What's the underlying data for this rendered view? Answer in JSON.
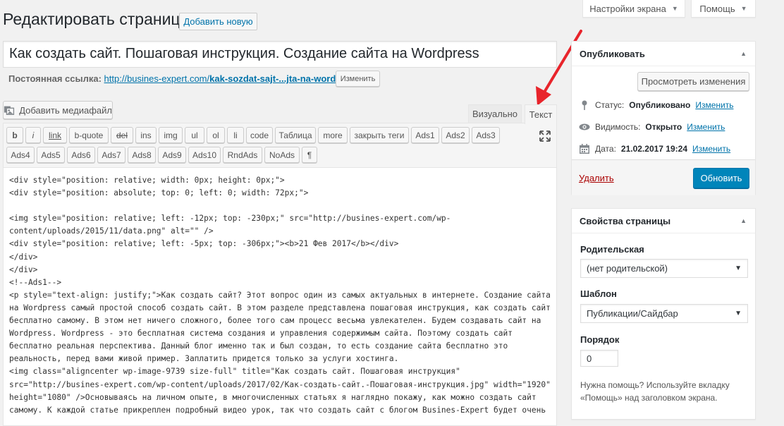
{
  "header": {
    "title": "Редактировать страницу",
    "add_new": "Добавить новую",
    "screen_options": "Настройки экрана",
    "help": "Помощь"
  },
  "post": {
    "title": "Как создать сайт. Пошаговая инструкция. Создание сайта на Wordpress",
    "permalink_label": "Постоянная ссылка:",
    "permalink_base": "http://busines-expert.com/",
    "permalink_slug": "kak-sozdat-sajt-...jta-na-wordpress",
    "permalink_end": "/",
    "permalink_edit": "Изменить"
  },
  "editor": {
    "add_media": "Добавить медиафайл",
    "tab_visual": "Визуально",
    "tab_text": "Текст",
    "toolbar_row1": [
      "b",
      "i",
      "link",
      "b-quote",
      "del",
      "ins",
      "img",
      "ul",
      "ol",
      "li",
      "code",
      "Таблица",
      "more",
      "закрыть теги",
      "Ads1",
      "Ads2",
      "Ads3"
    ],
    "toolbar_row2": [
      "Ads4",
      "Ads5",
      "Ads6",
      "Ads7",
      "Ads8",
      "Ads9",
      "Ads10",
      "RndAds",
      "NoAds",
      "¶"
    ],
    "content": "<div style=\"position: relative; width: 0px; height: 0px;\">\n<div style=\"position: absolute; top: 0; left: 0; width: 72px;\">\n\n<img style=\"position: relative; left: -12px; top: -230px;\" src=\"http://busines-expert.com/wp-\ncontent/uploads/2015/11/data.png\" alt=\"\" />\n<div style=\"position: relative; left: -5px; top: -306px;\"><b>21 Фев 2017</b></div>\n</div>\n</div>\n<!--Ads1-->\n<p style=\"text-align: justify;\">Как создать сайт? Этот вопрос один из самых актуальных в интернете. Создание сайта\nна Wordpress самый простой способ создать сайт. В этом разделе представлена пошаговая инструкция, как создать сайт\nбесплатно самому. В этом нет ничего сложного, более того сам процесс весьма увлекателен. Будем создавать сайт на\nWordpress. Wordpress - это бесплатная система создания и управления содержимым сайта. Поэтому создать сайт\nбесплатно реальная перспектива. Данный блог именно так и был создан, то есть создание сайта бесплатно это\nреальность, перед вами живой пример. Заплатить придется только за услуги хостинга.\n<img class=\"aligncenter wp-image-9739 size-full\" title=\"Как создать сайт. Пошаговая инструкция\"\nsrc=\"http://busines-expert.com/wp-content/uploads/2017/02/Как-создать-сайт.-Пошаговая-инструкция.jpg\" width=\"1920\"\nheight=\"1080\" />Основываясь на личном опыте, в многочисленных статьях я наглядно покажу, как можно создать сайт\nсамому. К каждой статье прикреплен подробный видео урок, так что создать сайт с блогом Busines-Expert будет очень"
  },
  "publish": {
    "title": "Опубликовать",
    "preview": "Просмотреть изменения",
    "status_label": "Статус:",
    "status_value": "Опубликовано",
    "status_edit": "Изменить",
    "visibility_label": "Видимость:",
    "visibility_value": "Открыто",
    "visibility_edit": "Изменить",
    "date_label": "Дата:",
    "date_value": "21.02.2017 19:24",
    "date_edit": "Изменить",
    "delete": "Удалить",
    "update": "Обновить"
  },
  "attributes": {
    "title": "Свойства страницы",
    "parent_label": "Родительская",
    "parent_value": "(нет родительской)",
    "template_label": "Шаблон",
    "template_value": "Публикации/Сайдбар",
    "order_label": "Порядок",
    "order_value": "0",
    "help_text_1": "Нужна помощь? Используйте вкладку",
    "help_text_2": "«Помощь» над заголовком экрана."
  },
  "colors": {
    "primary": "#0085ba",
    "link": "#0073aa",
    "delete": "#a00000",
    "arrow": "#e8242b"
  }
}
